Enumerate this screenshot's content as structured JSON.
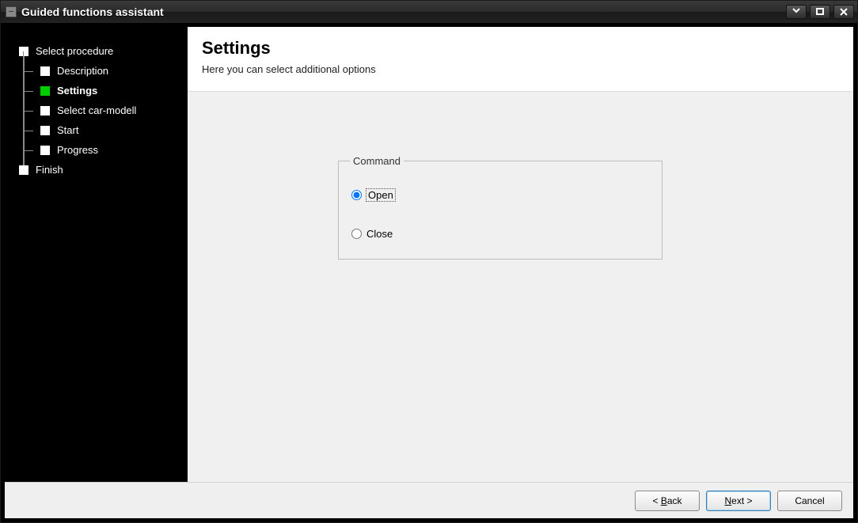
{
  "window": {
    "title": "Guided functions assistant"
  },
  "sidebar": {
    "steps": [
      {
        "label": "Select procedure",
        "active": false
      },
      {
        "label": "Description",
        "active": false
      },
      {
        "label": "Settings",
        "active": true
      },
      {
        "label": "Select car-modell",
        "active": false
      },
      {
        "label": "Start",
        "active": false
      },
      {
        "label": "Progress",
        "active": false
      },
      {
        "label": "Finish",
        "active": false
      }
    ]
  },
  "header": {
    "title": "Settings",
    "subtitle": "Here you can select additional options"
  },
  "command_group": {
    "legend": "Command",
    "options": [
      {
        "label": "Open",
        "selected": true
      },
      {
        "label": "Close",
        "selected": false
      }
    ]
  },
  "footer": {
    "back": "< Back",
    "next": "Next >",
    "cancel": "Cancel",
    "back_accesskey": "B",
    "next_accesskey": "N"
  }
}
